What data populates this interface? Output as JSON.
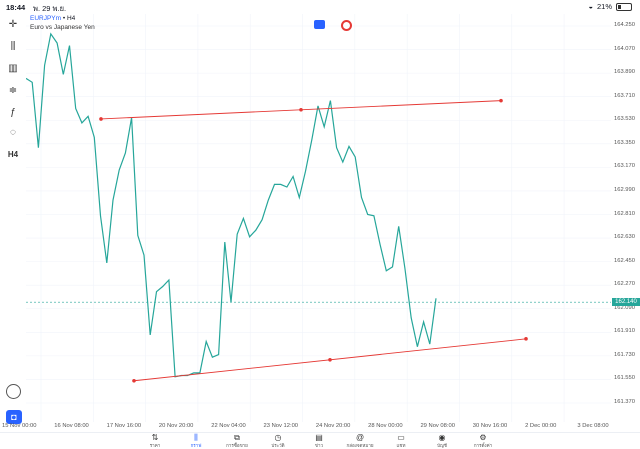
{
  "status": {
    "time": "18:44",
    "date": "พ. 29 พ.ย.",
    "battery": "21%"
  },
  "symbol": {
    "code": "EURJPYm",
    "interval": "H4",
    "description": "Euro vs Japanese Yen"
  },
  "toolbar": {
    "h4_label": "H4"
  },
  "price_axis": {
    "labels": [
      "164.250",
      "164.070",
      "163.890",
      "163.710",
      "163.530",
      "163.350",
      "163.170",
      "162.990",
      "162.810",
      "162.630",
      "162.450",
      "162.270",
      "162.090",
      "161.910",
      "161.730",
      "161.550",
      "161.370"
    ],
    "current_price": "162.140"
  },
  "time_axis": {
    "labels": [
      "15 Nov 00:00",
      "16 Nov 08:00",
      "17 Nov 16:00",
      "20 Nov 20:00",
      "22 Nov 04:00",
      "23 Nov 12:00",
      "24 Nov 20:00",
      "28 Nov 00:00",
      "29 Nov 08:00",
      "30 Nov 16:00",
      "2 Dec 00:00",
      "3 Dec 08:00"
    ]
  },
  "tabs": [
    {
      "label": "ราคา",
      "icon": "sort-icon"
    },
    {
      "label": "กราฟ",
      "icon": "candles-icon",
      "active": true
    },
    {
      "label": "การซื้อขาย",
      "icon": "trade-chart-icon"
    },
    {
      "label": "ประวัติ",
      "icon": "history-icon"
    },
    {
      "label": "ข่าว",
      "icon": "news-icon"
    },
    {
      "label": "กล่องจดหมาย",
      "icon": "at-icon"
    },
    {
      "label": "แชท",
      "icon": "chat-icon"
    },
    {
      "label": "บัญชี",
      "icon": "account-icon"
    },
    {
      "label": "การตั้งค่า",
      "icon": "settings-icon"
    }
  ],
  "chart_data": {
    "type": "line",
    "title": "EURJPYm • H4",
    "subtitle": "Euro vs Japanese Yen",
    "y_range": [
      161.37,
      164.25
    ],
    "x_ticks": [
      "15 Nov 00:00",
      "16 Nov 08:00",
      "17 Nov 16:00",
      "20 Nov 20:00",
      "22 Nov 04:00",
      "23 Nov 12:00",
      "24 Nov 20:00",
      "28 Nov 00:00",
      "29 Nov 08:00",
      "30 Nov 16:00",
      "2 Dec 00:00",
      "3 Dec 08:00"
    ],
    "series": [
      {
        "color": "#26a69a",
        "values": [
          163.85,
          163.82,
          163.32,
          163.95,
          164.19,
          164.12,
          163.88,
          164.1,
          163.62,
          163.51,
          163.56,
          163.4,
          162.8,
          162.44,
          162.92,
          163.15,
          163.28,
          163.55,
          162.65,
          162.5,
          161.89,
          162.22,
          162.26,
          162.31,
          161.57,
          161.58,
          161.58,
          161.6,
          161.6,
          161.84,
          161.72,
          161.74,
          162.6,
          162.14,
          162.66,
          162.78,
          162.64,
          162.69,
          162.77,
          162.92,
          163.04,
          163.04,
          163.02,
          163.1,
          162.94,
          163.14,
          163.38,
          163.64,
          163.48,
          163.68,
          163.32,
          163.21,
          163.33,
          163.25,
          162.94,
          162.81,
          162.8,
          162.58,
          162.38,
          162.41,
          162.72,
          162.4,
          162.02,
          161.8,
          161.99,
          161.82,
          162.17
        ]
      }
    ],
    "trendlines": [
      {
        "color": "#e53935",
        "from": [
          163.54
        ],
        "to": [
          163.68
        ]
      },
      {
        "color": "#e53935",
        "from": [
          161.54
        ],
        "to": [
          161.86
        ]
      }
    ],
    "current_price": 162.14,
    "grid": true
  }
}
